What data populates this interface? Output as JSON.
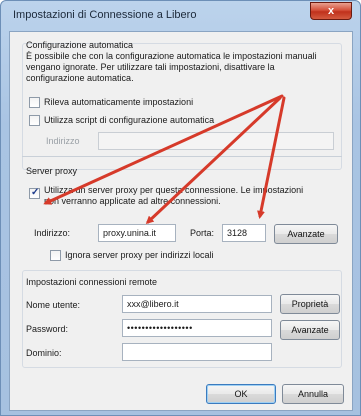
{
  "window": {
    "title": "Impostazioni di Connessione a Libero",
    "close_label": "x"
  },
  "auto": {
    "heading": "Configurazione automatica",
    "description": "È possibile che con la configurazione automatica le impostazioni manuali vengano ignorate. Per utilizzare tali impostazioni, disattivare la configurazione automatica.",
    "detect_label": "Rileva automaticamente impostazioni",
    "script_label": "Utilizza script di configurazione automatica",
    "address_label": "Indirizzo",
    "address_value": ""
  },
  "proxy": {
    "heading": "Server proxy",
    "use_proxy_label_line1": "Utilizza un server proxy per questa connessione. Le impostazioni",
    "use_proxy_label_line2": "non verranno applicate ad altre connessioni.",
    "use_proxy_checked": true,
    "address_label": "Indirizzo:",
    "address_value": "proxy.unina.it",
    "port_label": "Porta:",
    "port_value": "3128",
    "advanced_button": "Avanzate",
    "bypass_label": "Ignora server proxy per indirizzi locali",
    "bypass_checked": false
  },
  "remote": {
    "heading": "Impostazioni connessioni remote",
    "username_label": "Nome utente:",
    "username_value": "xxx@libero.it",
    "properties_button": "Proprietà",
    "password_label": "Password:",
    "password_value": "••••••••••••••••••",
    "advanced_button": "Avanzate",
    "domain_label": "Dominio:",
    "domain_value": ""
  },
  "footer": {
    "ok_button": "OK",
    "cancel_button": "Annulla"
  },
  "colors": {
    "arrow": "#d63a2a",
    "title_bar": "#a9c4e3",
    "close_button": "#c0311c"
  }
}
